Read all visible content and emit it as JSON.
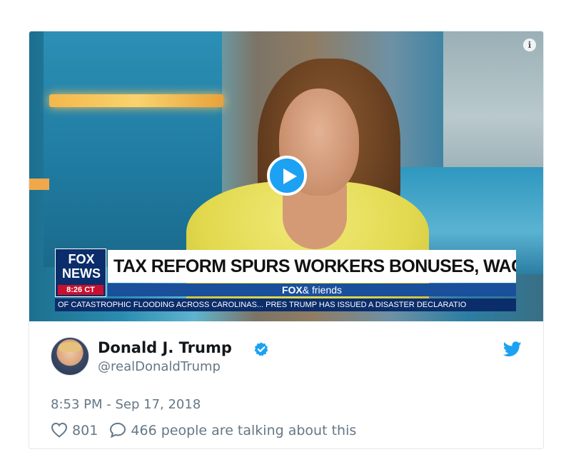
{
  "video": {
    "chyron": {
      "logo_top": "FOX",
      "logo_bottom": "NEWS",
      "time": "8:26 CT",
      "headline": "TAX REFORM SPURS WORKERS BONUSES, WAGE RAISES",
      "show_brand": "FOX",
      "show_suffix": "& friends",
      "ticker": "OF CATASTROPHIC FLOODING ACROSS CAROLINAS...   PRES TRUMP HAS ISSUED A DISASTER DECLARATIO"
    },
    "info_icon": "i"
  },
  "tweet": {
    "display_name": "Donald J. Trump",
    "handle": "@realDonaldTrump",
    "timestamp": "8:53 PM - Sep 17, 2018",
    "likes": "801",
    "talking": "466 people are talking about this"
  },
  "colors": {
    "twitter_blue": "#1da1f2",
    "secondary_text": "#657786",
    "primary_text": "#14171a"
  },
  "icons": {
    "verified": "verified-badge-icon",
    "twitter": "twitter-bird-icon",
    "like": "heart-icon",
    "reply": "speech-bubble-icon",
    "play": "play-icon",
    "info": "info-icon"
  }
}
